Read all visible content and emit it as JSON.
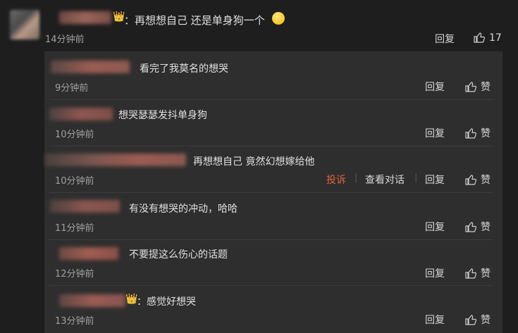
{
  "main_comment": {
    "text": "：再想想自己 还是单身狗一个",
    "time": "14分钟前",
    "reply_label": "回复",
    "likes": "17"
  },
  "replies": [
    {
      "text": "看完了我莫名的想哭",
      "time": "9分钟前",
      "reply_label": "回复",
      "like_label": "赞"
    },
    {
      "text": "想哭瑟瑟发抖单身狗",
      "time": "10分钟前",
      "reply_label": "回复",
      "like_label": "赞"
    },
    {
      "text": "再想想自己 竟然幻想嫁给他",
      "time": "10分钟前",
      "report_label": "投诉",
      "view_dialog_label": "查看对话",
      "reply_label": "回复",
      "like_label": "赞"
    },
    {
      "text": "有没有想哭的冲动，哈哈",
      "time": "11分钟前",
      "reply_label": "回复",
      "like_label": "赞"
    },
    {
      "text": "不要提这么伤心的话题",
      "time": "12分钟前",
      "reply_label": "回复",
      "like_label": "赞"
    },
    {
      "text": "：感觉好想哭",
      "time": "13分钟前",
      "reply_label": "回复",
      "like_label": "赞"
    }
  ],
  "colors": {
    "background": "#1e1e1e",
    "panel": "#2e2e2e",
    "report": "#e8603c"
  }
}
